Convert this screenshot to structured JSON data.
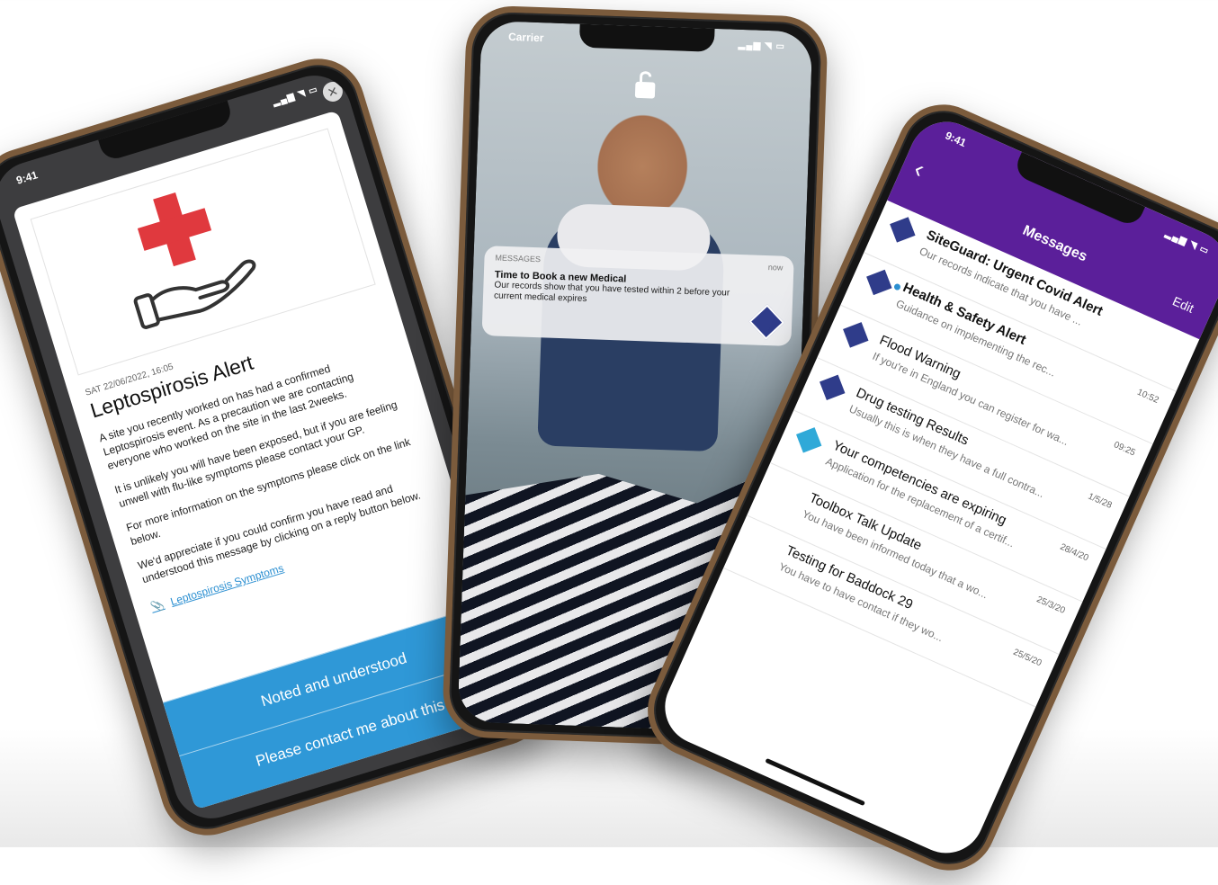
{
  "left_phone": {
    "status_time": "9:41",
    "alert": {
      "date": "SAT 22/06/2022, 16:05",
      "title": "Leptospirosis Alert",
      "paragraphs": [
        "A site you recently worked on has had a confirmed Leptospirosis event. As a precaution we are contacting everyone who worked on the site in the last 2weeks.",
        "It is unlikely you will have been exposed, but if you are feeling unwell with flu-like symptoms please contact your GP.",
        "For more information on the symptoms please click on the link below.",
        "We'd appreciate if you could confirm you have read and understood this message by clicking on a reply button below."
      ],
      "link_label": "Leptospirosis Symptoms",
      "buttons": [
        "Noted and understood",
        "Please contact me about this"
      ]
    },
    "close_symbol": "✕"
  },
  "middle_phone": {
    "status_time": "Carrier",
    "notification": {
      "app_name": "MESSAGES",
      "time": "now",
      "title": "Time to Book a new Medical",
      "text": "Our records show that you have tested within 2 before your current medical expires"
    }
  },
  "right_phone": {
    "status_time": "9:41",
    "header_title": "Messages",
    "edit_label": "Edit",
    "back_symbol": "‹",
    "messages": [
      {
        "title": "SiteGuard: Urgent Covid Alert",
        "snippet": "Our records indicate that you have ...",
        "time": "",
        "unread": false
      },
      {
        "title": "Health & Safety Alert",
        "snippet": "Guidance on implementing the rec...",
        "time": "10:52",
        "unread": true
      },
      {
        "title": "Flood Warning",
        "snippet": "If you're in England you can register for wa...",
        "time": "09:25",
        "unread": false
      },
      {
        "title": "Drug testing Results",
        "snippet": "Usually this is when they have a full contra...",
        "time": "1/5/28",
        "unread": false
      },
      {
        "title": "Your competencies are expiring",
        "snippet": "Application for the replacement of a certif...",
        "time": "28/4/20",
        "unread": false
      },
      {
        "title": "Toolbox Talk Update",
        "snippet": "You have been informed today that a wo...",
        "time": "25/3/20",
        "unread": false
      },
      {
        "title": "Testing for Baddock 29",
        "snippet": "You have to have contact if they wo...",
        "time": "25/5/20",
        "unread": false
      }
    ]
  },
  "colors": {
    "purple": "#5b1f9a",
    "blue": "#2f98d7",
    "red": "#e0393e",
    "bronze": "#7b5b3c"
  }
}
